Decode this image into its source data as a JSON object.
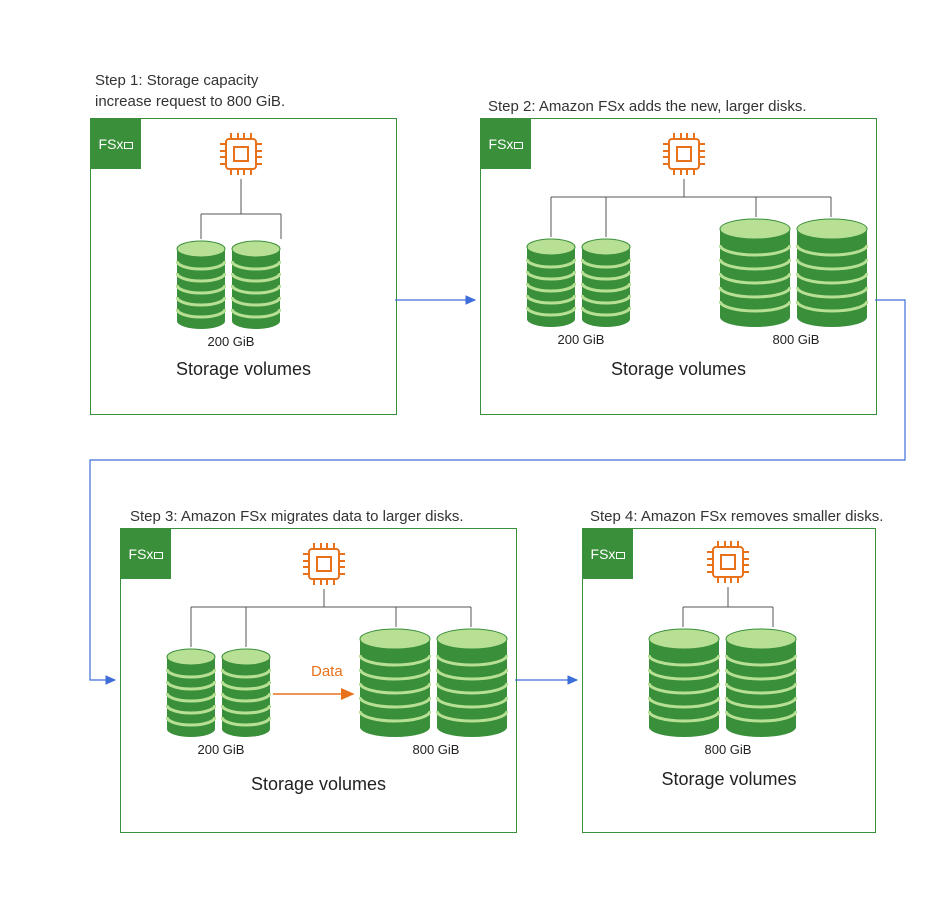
{
  "steps": {
    "s1": {
      "title_line1": "Step 1: Storage capacity",
      "title_line2": "increase request to 800 GiB."
    },
    "s2": {
      "title": "Step 2: Amazon FSx adds the new, larger disks."
    },
    "s3": {
      "title": "Step 3: Amazon FSx migrates data to larger disks."
    },
    "s4": {
      "title": "Step 4: Amazon FSx removes  smaller disks."
    }
  },
  "badge": {
    "label": "FSx"
  },
  "labels": {
    "vol": "Storage volumes",
    "small_size": "200 GiB",
    "large_size": "800 GiB",
    "data_arrow": "Data"
  },
  "colors": {
    "panel_border": "#3a8f3a",
    "badge_bg": "#3a8f3a",
    "chip": "#e8711c",
    "arrow": "#3d6dd8",
    "disk_dark": "#3a8f3a",
    "disk_light": "#b7e094"
  },
  "chart_data": {
    "type": "diagram",
    "title": "Amazon FSx storage capacity increase workflow",
    "nodes": [
      {
        "id": "step1",
        "label": "Storage capacity increase request to 800 GiB",
        "volumes_gib": [
          200
        ],
        "text": "Storage volumes"
      },
      {
        "id": "step2",
        "label": "Amazon FSx adds the new, larger disks",
        "volumes_gib": [
          200,
          800
        ],
        "text": "Storage volumes"
      },
      {
        "id": "step3",
        "label": "Amazon FSx migrates data to larger disks",
        "volumes_gib": [
          200,
          800
        ],
        "migration": {
          "from_gib": 200,
          "to_gib": 800,
          "label": "Data"
        },
        "text": "Storage volumes"
      },
      {
        "id": "step4",
        "label": "Amazon FSx removes smaller disks",
        "volumes_gib": [
          800
        ],
        "text": "Storage volumes"
      }
    ],
    "edges": [
      {
        "from": "step1",
        "to": "step2"
      },
      {
        "from": "step2",
        "to": "step3"
      },
      {
        "from": "step3",
        "to": "step4"
      }
    ]
  }
}
